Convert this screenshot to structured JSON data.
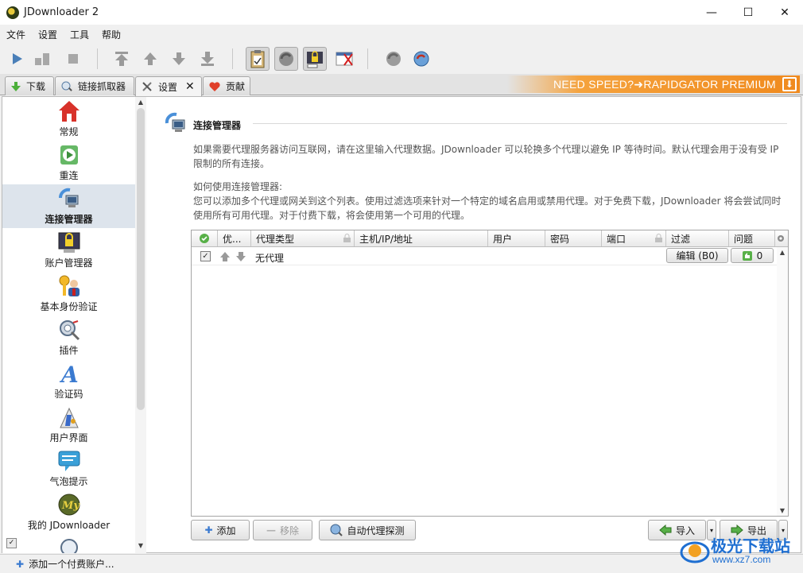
{
  "window": {
    "title": "JDownloader 2",
    "minimize": "—",
    "maximize": "☐",
    "close": "✕"
  },
  "menu": [
    "文件",
    "设置",
    "工具",
    "帮助"
  ],
  "tabs": [
    {
      "label": "下载",
      "icon": "download-arrow-icon"
    },
    {
      "label": "链接抓取器",
      "icon": "linkgrabber-icon"
    },
    {
      "label": "设置",
      "icon": "settings-tools-icon",
      "close": "✕"
    },
    {
      "label": "贡献",
      "icon": "heart-icon"
    }
  ],
  "banner": {
    "text": "NEED SPEED?➜RAPIDGATOR PREMIUM",
    "icon": "download-icon"
  },
  "sidebar": {
    "items": [
      {
        "label": "常规",
        "icon": "house-icon"
      },
      {
        "label": "重连",
        "icon": "reconnect-icon"
      },
      {
        "label": "连接管理器",
        "icon": "connection-manager-icon"
      },
      {
        "label": "账户管理器",
        "icon": "account-lock-icon"
      },
      {
        "label": "基本身份验证",
        "icon": "key-user-icon"
      },
      {
        "label": "插件",
        "icon": "plugin-gear-icon"
      },
      {
        "label": "验证码",
        "icon": "captcha-a-icon"
      },
      {
        "label": "用户界面",
        "icon": "paint-palette-icon"
      },
      {
        "label": "气泡提示",
        "icon": "speech-bubble-icon"
      },
      {
        "label": "我的 JDownloader",
        "icon": "my-jd-icon"
      }
    ],
    "active_index": 2
  },
  "panel": {
    "title": "连接管理器",
    "description": "如果需要代理服务器访问互联网，请在这里输入代理数据。JDownloader 可以轮换多个代理以避免 IP 等待时间。默认代理会用于没有受 IP 限制的所有连接。",
    "howto_heading": "如何使用连接管理器:",
    "howto_text": "您可以添加多个代理或网关到这个列表。使用过滤选项来针对一个特定的域名启用或禁用代理。对于免费下载，JDownloader 将会尝试同时使用所有可用代理。对于付费下载，将会使用第一个可用的代理。"
  },
  "table": {
    "columns": [
      "",
      "优...",
      "代理类型",
      "主机/IP/地址",
      "用户",
      "密码",
      "端口",
      "过滤",
      "问题"
    ],
    "rows": [
      {
        "enabled": true,
        "type": "无代理",
        "filter_button": "编辑 (B0)",
        "issues": "0"
      }
    ]
  },
  "buttons": {
    "add": "添加",
    "remove": "移除",
    "auto_detect": "自动代理探测",
    "import": "导入",
    "export": "导出"
  },
  "status": {
    "add_premium": "添加一个付费账户..."
  },
  "watermark": {
    "brand": "极光下载站",
    "url": "www.xz7.com"
  },
  "colors": {
    "accent_orange": "#f08a1e",
    "active_item": "#dde4ec"
  }
}
